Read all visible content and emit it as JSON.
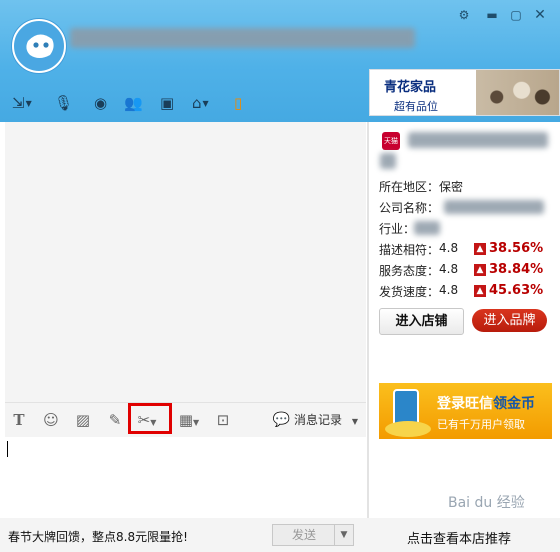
{
  "header": {
    "window_controls": [
      "gear-icon",
      "minimize-icon",
      "maximize-icon",
      "close-icon"
    ],
    "toolbar_icons": [
      "send-file-icon",
      "voice-icon",
      "camera-icon",
      "multi-chat-icon",
      "remote-screen-icon",
      "app-icon",
      "mobile-icon"
    ],
    "ad": {
      "line1": "青花家品",
      "line2": "超有品位"
    }
  },
  "input_toolbar": {
    "icons": [
      "font-icon",
      "emoji-icon",
      "image-icon",
      "edit-icon",
      "scissors-icon",
      "table-icon",
      "screen-icon"
    ],
    "history_label": "消息记录"
  },
  "footer": {
    "promo_text": "春节大牌回馈，整点8.8元限量抢!",
    "send_label": "发送",
    "recommend_label": "点击查看本店推荐"
  },
  "shop": {
    "badge": "天猫",
    "location": "所在地区：保密",
    "company": "公司名称：",
    "industry": "行业：",
    "ratings": [
      {
        "label": "描述相符：",
        "score": "4.8",
        "pct": "38.56%"
      },
      {
        "label": "服务态度：",
        "score": "4.8",
        "pct": "38.84%"
      },
      {
        "label": "发货速度：",
        "score": "4.8",
        "pct": "45.63%"
      }
    ],
    "enter_shop": "进入店铺",
    "enter_brand": "进入品牌",
    "banner": {
      "line1_a": "登录旺信",
      "line1_b": "领金币",
      "line2": "已有千万用户领取"
    }
  },
  "watermark": "Bai du 经验",
  "colors": {
    "header": "#4fb1e8",
    "highlight": "#e00000",
    "rate_up": "#b80000",
    "brand_button": "#c8240f"
  }
}
